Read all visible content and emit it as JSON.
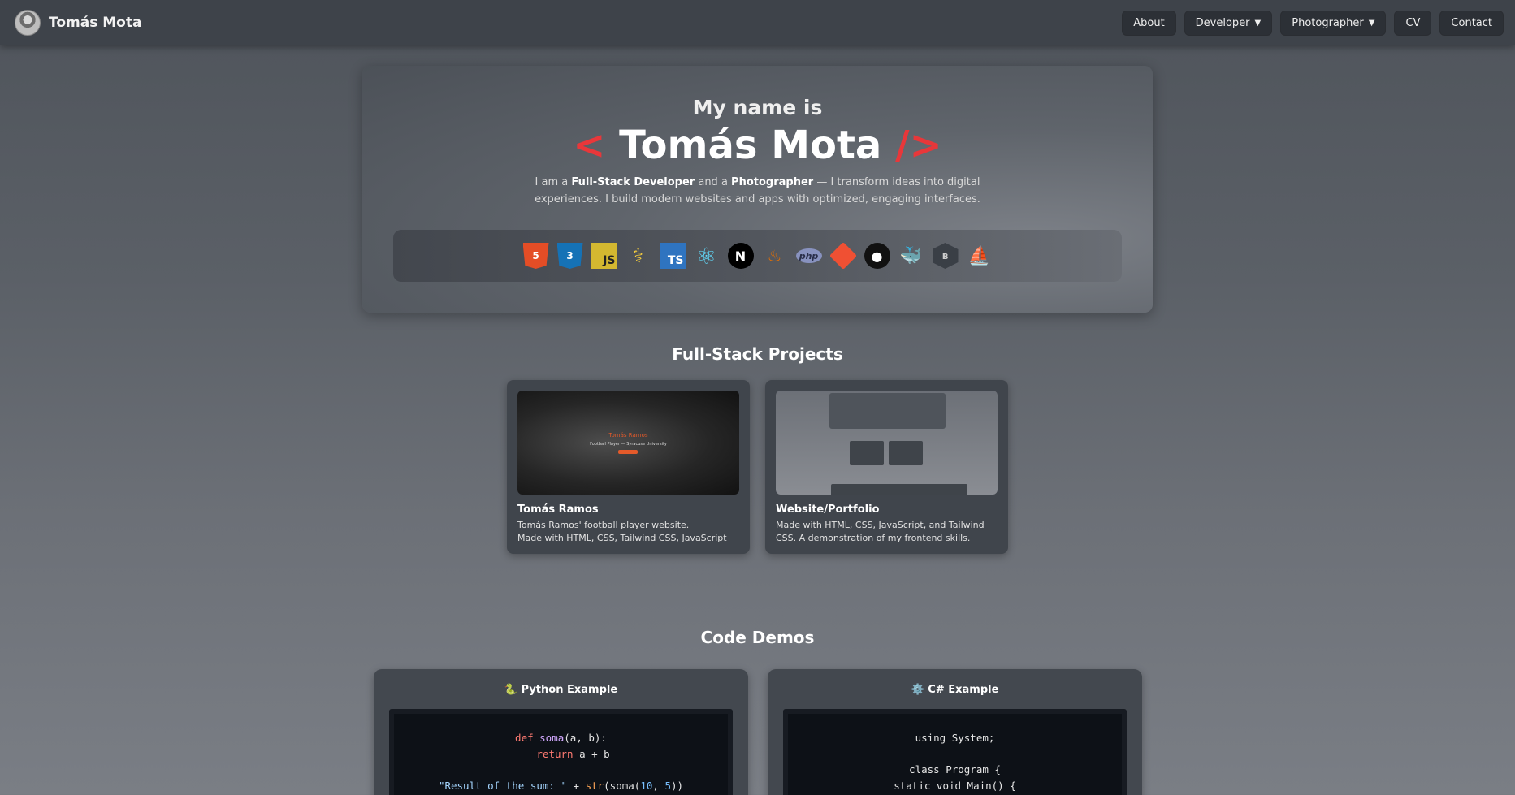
{
  "navbar": {
    "brand_name": "Tomás Mota",
    "links": [
      {
        "label": "About",
        "dropdown": false
      },
      {
        "label": "Developer",
        "dropdown": true
      },
      {
        "label": "Photographer",
        "dropdown": true
      },
      {
        "label": "CV",
        "dropdown": false
      },
      {
        "label": "Contact",
        "dropdown": false
      }
    ],
    "caret": "▼"
  },
  "hero": {
    "intro": "My name is",
    "bracket_open": "<",
    "name": "Tomás Mota",
    "bracket_close": "/>",
    "desc_1": "I am a ",
    "desc_role_1": "Full-Stack Developer",
    "desc_2": " and a ",
    "desc_role_2": "Photographer",
    "desc_3": " — I transform ideas into digital experiences. I build modern websites and apps with optimized, engaging interfaces.",
    "accent_color": "#e8373a",
    "tech_icons": {
      "html": {
        "name": "html5-icon",
        "glyph": "5"
      },
      "css": {
        "name": "css3-icon",
        "glyph": "3"
      },
      "js": {
        "name": "javascript-icon",
        "glyph": "JS"
      },
      "python": {
        "name": "python-icon",
        "glyph": "⚕"
      },
      "ts": {
        "name": "typescript-icon",
        "glyph": "TS"
      },
      "react": {
        "name": "react-icon",
        "glyph": "⚛"
      },
      "next": {
        "name": "nextjs-icon",
        "glyph": "N"
      },
      "java": {
        "name": "java-icon",
        "glyph": "♨"
      },
      "php": {
        "name": "php-icon",
        "glyph": "php"
      },
      "git": {
        "name": "git-icon",
        "glyph": ""
      },
      "github": {
        "name": "github-icon",
        "glyph": "●"
      },
      "docker": {
        "name": "docker-icon",
        "glyph": "🐳"
      },
      "bootstrap": {
        "name": "bootstrap-icon",
        "glyph": "ʙ"
      },
      "sail": {
        "name": "sailboat-icon",
        "glyph": "⛵"
      }
    }
  },
  "projects": {
    "title": "Full-Stack Projects",
    "items": [
      {
        "name": "Tomás Ramos",
        "desc_1": "Tomás Ramos' football player website.",
        "desc_2": "Made with HTML, CSS, Tailwind CSS, JavaScript",
        "thumb_title": "Tomás Ramos",
        "thumb_sub": "Football Player — Syracuse University"
      },
      {
        "name": "Website/Portfolio",
        "desc_1": "Made with HTML, CSS, JavaScript, and Tailwind CSS. A demonstration of my frontend skills.",
        "desc_2": ""
      }
    ]
  },
  "demos": {
    "title": "Code Demos",
    "python": {
      "title": "🐍 Python Example",
      "line1_kw": "def",
      "line1_fn": "soma",
      "line1_rest": "(a, b):",
      "line2_kw": "return",
      "line2_rest": " a + b",
      "line3_str": "\"Result of the sum: \"",
      "line3_op": " + ",
      "line3_bi": "str",
      "line3_p1": "(soma(",
      "line3_n1": "10",
      "line3_c": ", ",
      "line3_n2": "5",
      "line3_p2": "))"
    },
    "csharp": {
      "title": "⚙️ C# Example",
      "line1": "using System;",
      "line2": "class Program {",
      "line3": "static void Main() {"
    }
  }
}
